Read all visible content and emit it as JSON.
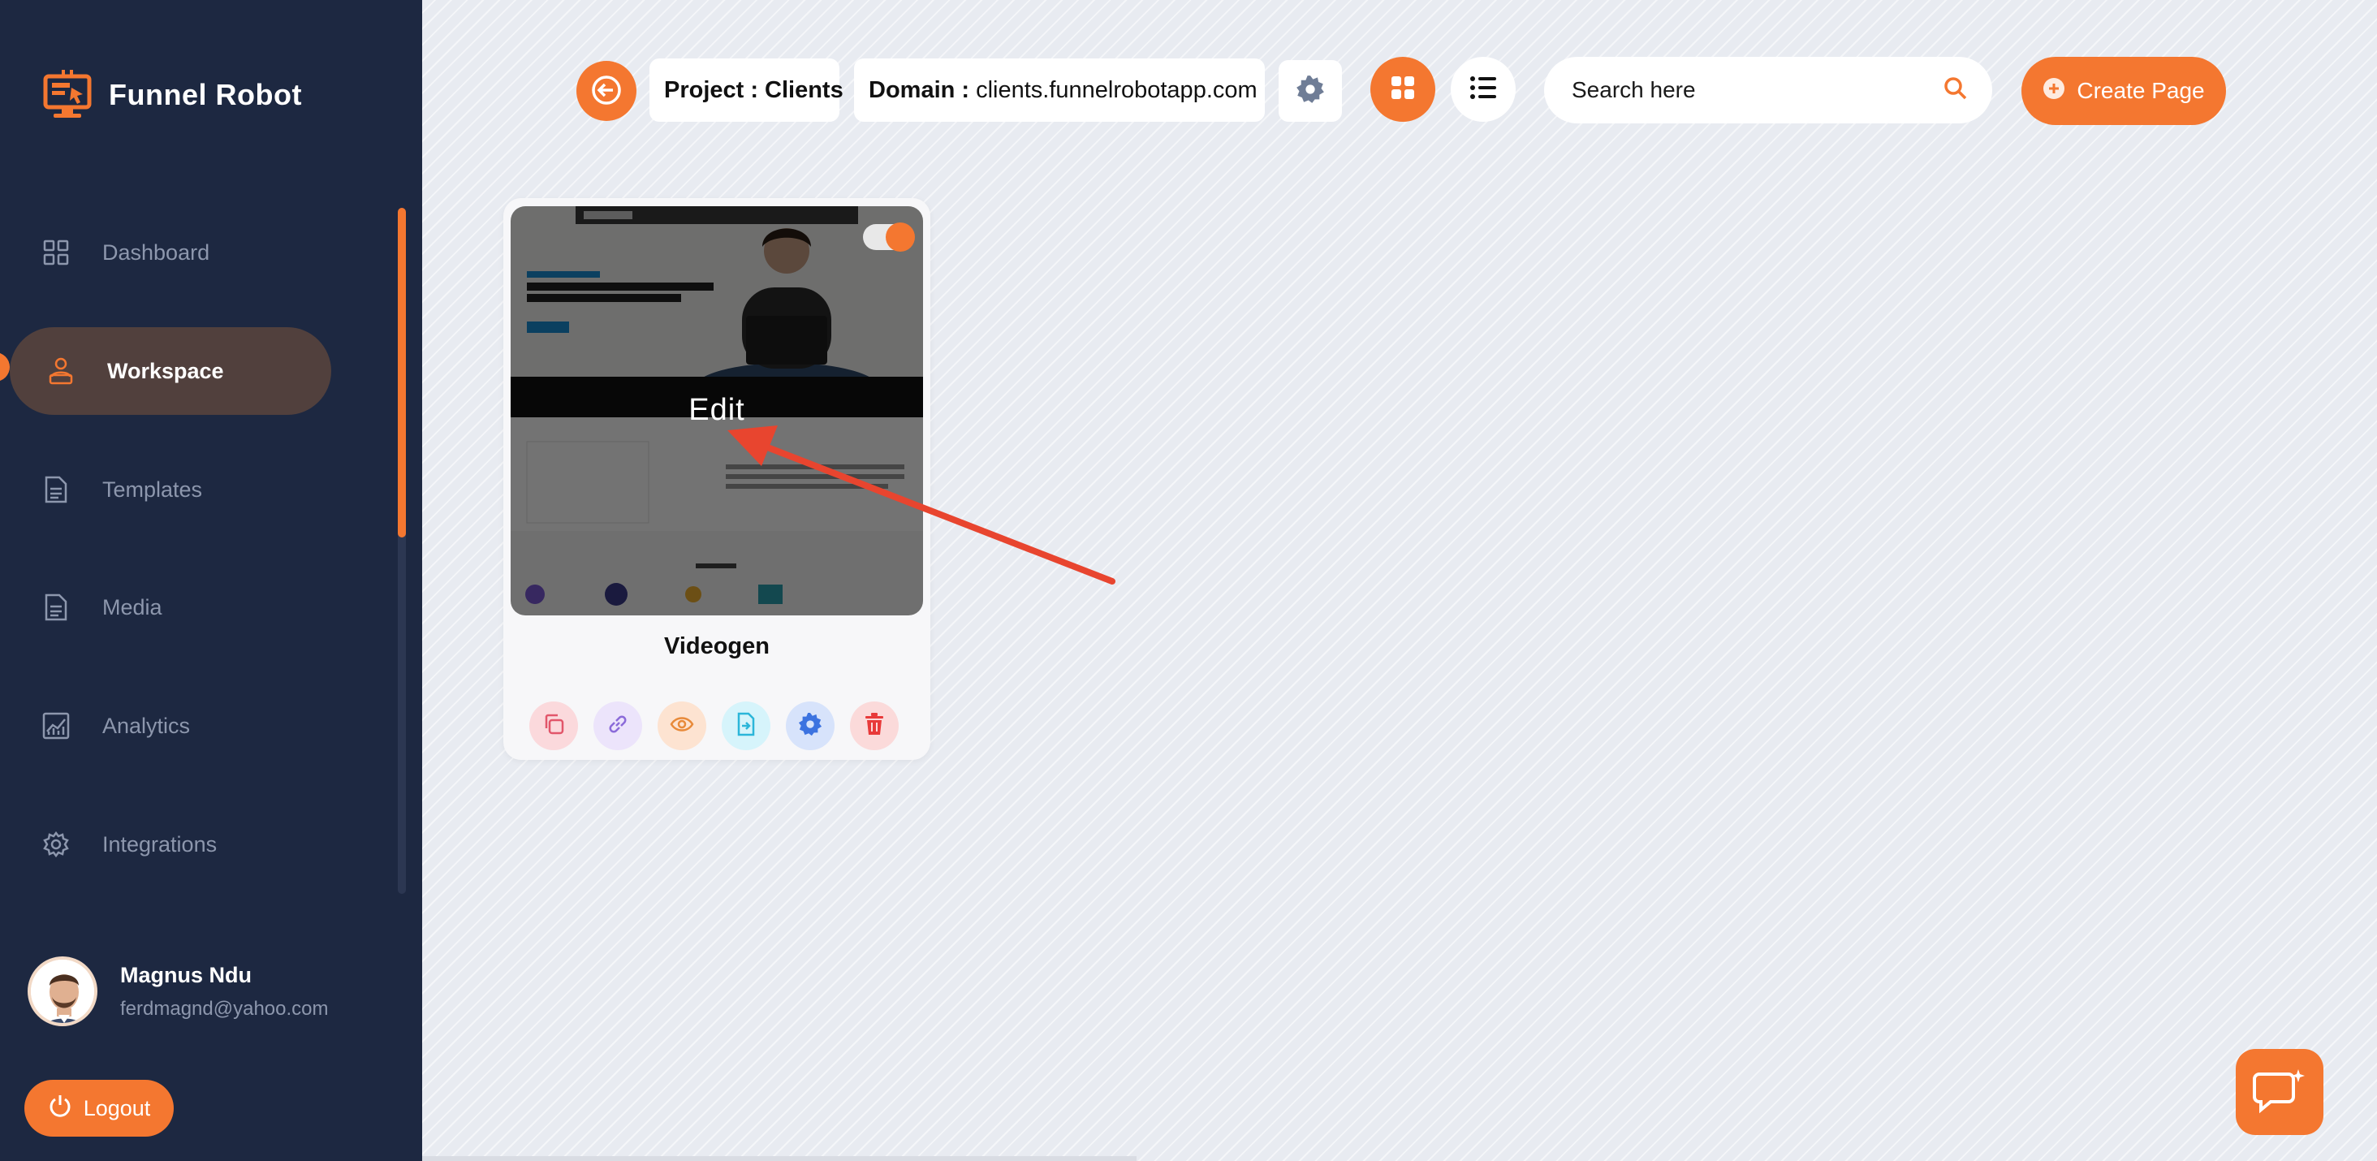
{
  "app": {
    "name": "Funnel Robot"
  },
  "sidebar": {
    "items": [
      {
        "label": "Dashboard",
        "icon": "grid-icon"
      },
      {
        "label": "Workspace",
        "icon": "user-laptop-icon",
        "active": true
      },
      {
        "label": "Templates",
        "icon": "document-icon"
      },
      {
        "label": "Media",
        "icon": "document-icon"
      },
      {
        "label": "Analytics",
        "icon": "chart-icon"
      },
      {
        "label": "Integrations",
        "icon": "gear-icon"
      }
    ],
    "user": {
      "name": "Magnus Ndu",
      "email": "ferdmagnd@yahoo.com"
    },
    "logout_label": "Logout"
  },
  "header": {
    "project_label": "Project :",
    "project_value": "Clients",
    "domain_label": "Domain :",
    "domain_value": "clients.funnelrobotapp.com",
    "search_placeholder": "Search here",
    "create_label": "Create Page"
  },
  "card": {
    "title": "Videogen",
    "overlay_label": "Edit",
    "toggle_on": true,
    "actions": [
      "copy-icon",
      "link-icon",
      "eye-icon",
      "export-icon",
      "gear-icon",
      "trash-icon"
    ]
  },
  "colors": {
    "accent": "#f47730",
    "sidebar_bg": "#1d2841",
    "active_item_bg": "#51403d",
    "annotation_arrow": "#e8452f"
  }
}
